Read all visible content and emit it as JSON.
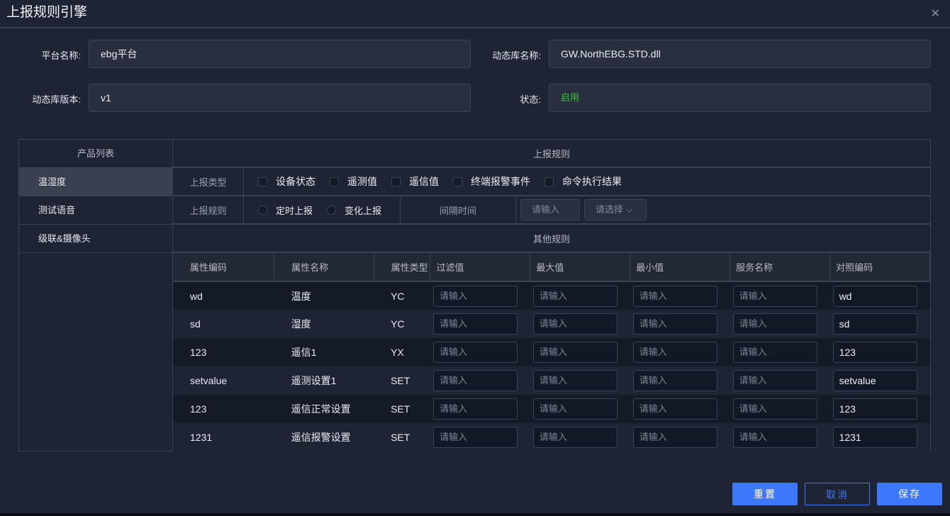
{
  "title": "上报规则引擎",
  "form": {
    "platform_label": "平台名称:",
    "platform_value": "ebg平台",
    "lib_label": "动态库名称:",
    "lib_value": "GW.NorthEBG.STD.dll",
    "version_label": "动态库版本:",
    "version_value": "v1",
    "status_label": "状态:",
    "status_value": "启用",
    "status_color": "#3fc23f"
  },
  "products": {
    "header": "产品列表",
    "items": [
      "温湿度",
      "测试语音",
      "级联&摄像头"
    ]
  },
  "rules": {
    "header": "上报规则",
    "type_label": "上报类型",
    "types": [
      "设备状态",
      "遥测值",
      "遥信值",
      "终端报警事件",
      "命令执行结果"
    ],
    "rule_label": "上报规则",
    "rule_options": [
      "定时上报",
      "变化上报"
    ],
    "interval_label": "间隔时间",
    "interval_placeholder": "请输入",
    "select_placeholder": "请选择",
    "other_header": "其他规则"
  },
  "table": {
    "columns": [
      "属性编码",
      "属性名称",
      "属性类型",
      "过滤值",
      "最大值",
      "最小值",
      "服务名称",
      "对照编码"
    ],
    "placeholder": "请输入",
    "rows": [
      {
        "code": "wd",
        "name": "温度",
        "type": "YC",
        "ref": "wd"
      },
      {
        "code": "sd",
        "name": "湿度",
        "type": "YC",
        "ref": "sd"
      },
      {
        "code": "123",
        "name": "遥信1",
        "type": "YX",
        "ref": "123"
      },
      {
        "code": "setvalue",
        "name": "遥测设置1",
        "type": "SET",
        "ref": "setvalue"
      },
      {
        "code": "123",
        "name": "遥信正常设置",
        "type": "SET",
        "ref": "123"
      },
      {
        "code": "1231",
        "name": "遥信报警设置",
        "type": "SET",
        "ref": "1231"
      }
    ]
  },
  "buttons": {
    "reset": "重置",
    "cancel": "取消",
    "save": "保存"
  }
}
